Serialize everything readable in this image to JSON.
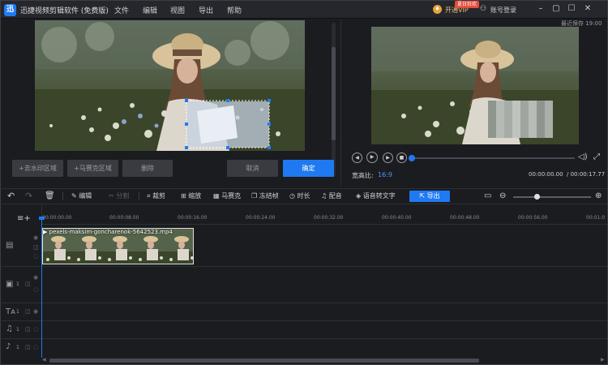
{
  "app": {
    "title": "迅捷视频剪辑软件 (免费版)",
    "logo": "迅"
  },
  "menu": [
    "文件",
    "编辑",
    "视图",
    "导出",
    "帮助"
  ],
  "vip": {
    "badge": "夏日狂欢",
    "label": "开通VIP"
  },
  "login": "账号登录",
  "window_controls": {
    "minimize": "–",
    "restore": "▢",
    "maximize": "☐",
    "close": "✕"
  },
  "editor": {
    "buttons": [
      "+去水印区域",
      "+马赛克区域",
      "删除",
      "取消",
      "确定"
    ]
  },
  "preview": {
    "autosave": "最近保存 19:00",
    "ratio_label": "宽高比:",
    "ratio_value": "16:9",
    "time_current": "00:00:00.00",
    "time_total": "/ 00:00:17.77",
    "progress": 0
  },
  "toolbar": {
    "edit": "编辑",
    "split": "分割",
    "crop": "裁剪",
    "zoom": "缩放",
    "mosaic": "马赛克",
    "freeze": "冻结帧",
    "duration": "时长",
    "dub": "配音",
    "speech": "语音转文字",
    "export": "导出"
  },
  "timeline": {
    "ticks": [
      "00:00:00.00",
      "00:00:08.00",
      "00:00:16.00",
      "00:00:24.00",
      "00:00:32.00",
      "00:00:40.00",
      "00:00:48.00",
      "00:00:56.00",
      "00:01:0"
    ],
    "clip_name": "pexels-maksim-goncharenok-5642523.mp4",
    "track_num": "1",
    "zoom_level": 0.3
  },
  "colors": {
    "accent": "#1f7af2",
    "background": "#1b1c20",
    "vip": "#e7a23b",
    "badge": "#e64b3c"
  }
}
